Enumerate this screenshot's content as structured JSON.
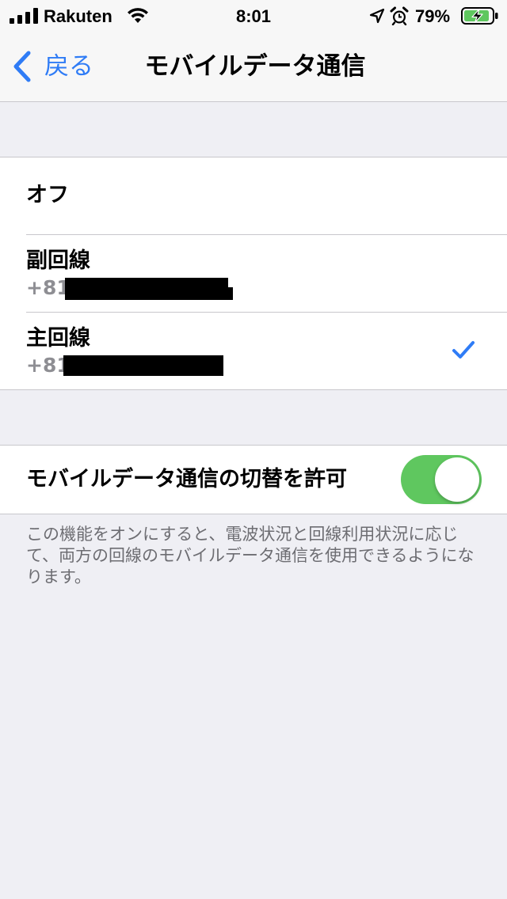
{
  "status_bar": {
    "carrier": "Rakuten",
    "time": "8:01",
    "battery_percent": "79%",
    "icons": [
      "signal-icon",
      "wifi-icon",
      "location-icon",
      "alarm-icon",
      "battery-charging-icon"
    ]
  },
  "nav": {
    "back_label": "戻る",
    "title": "モバイルデータ通信"
  },
  "lines": {
    "off_label": "オフ",
    "secondary": {
      "label": "副回線",
      "number": "+81"
    },
    "primary": {
      "label": "主回線",
      "number": "+81",
      "selected": true
    }
  },
  "switch": {
    "label": "モバイルデータ通信の切替を許可",
    "on": true
  },
  "footer": "この機能をオンにすると、電波状況と回線利用状況に応じて、両方の回線のモバイルデータ通信を使用できるようになります。",
  "colors": {
    "accent": "#2f7cf6",
    "toggle_on": "#5fc75f",
    "background": "#efeff4",
    "secondary_text": "#8e8e93"
  }
}
